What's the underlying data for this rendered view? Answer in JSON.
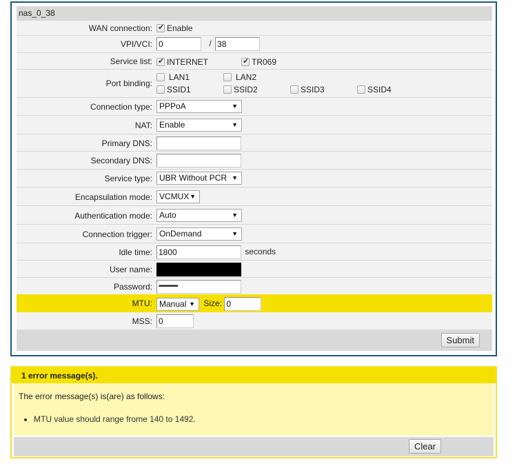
{
  "config": {
    "title": "nas_0_38",
    "wan_connection": {
      "label": "WAN connection:",
      "checkbox_label": "Enable",
      "checked": true
    },
    "vpi_vci": {
      "label": "VPI/VCI:",
      "vpi": "0",
      "separator": "/",
      "vci": "38"
    },
    "service_list": {
      "label": "Service list:",
      "items": [
        {
          "label": "INTERNET",
          "checked": true
        },
        {
          "label": "TR069",
          "checked": true
        }
      ]
    },
    "port_binding": {
      "label": "Port binding:",
      "items": [
        {
          "label": "LAN1",
          "checked": false
        },
        {
          "label": "LAN2",
          "checked": false
        },
        {
          "label": "SSID1",
          "checked": false
        },
        {
          "label": "SSID2",
          "checked": false
        },
        {
          "label": "SSID3",
          "checked": false
        },
        {
          "label": "SSID4",
          "checked": false
        }
      ]
    },
    "connection_type": {
      "label": "Connection type:",
      "value": "PPPoA"
    },
    "nat": {
      "label": "NAT:",
      "value": "Enable"
    },
    "primary_dns": {
      "label": "Primary DNS:",
      "value": ""
    },
    "secondary_dns": {
      "label": "Secondary DNS:",
      "value": ""
    },
    "service_type": {
      "label": "Service type:",
      "value": "UBR Without PCR"
    },
    "encapsulation_mode": {
      "label": "Encapsulation mode:",
      "value": "VCMUX"
    },
    "authentication_mode": {
      "label": "Authentication mode:",
      "value": "Auto"
    },
    "connection_trigger": {
      "label": "Connection trigger:",
      "value": "OnDemand"
    },
    "idle_time": {
      "label": "Idle time:",
      "value": "1800",
      "unit": "seconds"
    },
    "user_name": {
      "label": "User name:",
      "value": ""
    },
    "password": {
      "label": "Password:",
      "value": "•••••••••••"
    },
    "mtu": {
      "label": "MTU:",
      "mode": "Manual",
      "size_label": "Size:",
      "size": "0"
    },
    "mss": {
      "label": "MSS:",
      "value": "0"
    },
    "submit_label": "Submit",
    "select_arrow": "▼"
  },
  "errors": {
    "header": "1 error message(s).",
    "intro": "The error message(s) is(are) as follows:",
    "messages": [
      "MTU value should range frome 140 to 1492."
    ],
    "clear_label": "Clear"
  },
  "colors": {
    "panel_border": "#1d5a77",
    "highlight_yellow": "#f5e100",
    "error_body": "#fdf8b4",
    "footer_gray": "#d9d9d9",
    "row_bg": "#f2f2f2"
  }
}
